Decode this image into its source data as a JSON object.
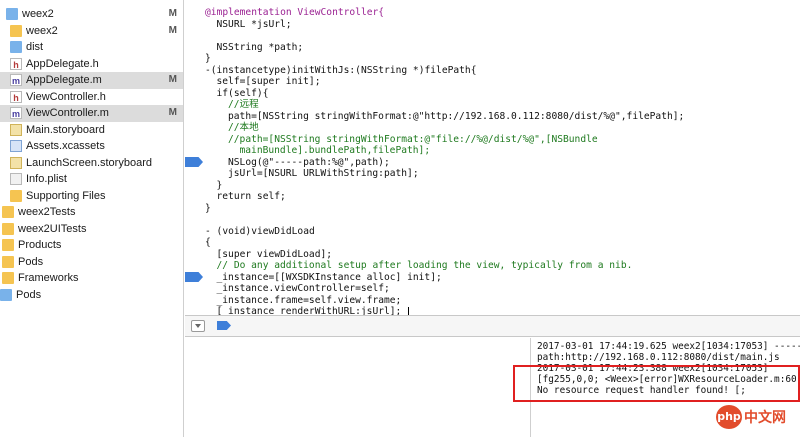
{
  "navigator": {
    "items": [
      {
        "label": "weex2",
        "icon": "project-icon",
        "badge": "M"
      },
      {
        "label": "weex2",
        "icon": "folder-icon",
        "badge": "M"
      },
      {
        "label": "dist",
        "icon": "folder-reference-icon",
        "badge": ""
      },
      {
        "label": "AppDelegate.h",
        "icon": "header-file-icon",
        "badge": ""
      },
      {
        "label": "AppDelegate.m",
        "icon": "implementation-file-icon",
        "badge": "M"
      },
      {
        "label": "ViewController.h",
        "icon": "header-file-icon",
        "badge": ""
      },
      {
        "label": "ViewController.m",
        "icon": "implementation-file-icon",
        "badge": "M"
      },
      {
        "label": "Main.storyboard",
        "icon": "storyboard-icon",
        "badge": ""
      },
      {
        "label": "Assets.xcassets",
        "icon": "asset-catalog-icon",
        "badge": ""
      },
      {
        "label": "LaunchScreen.storyboard",
        "icon": "storyboard-icon",
        "badge": ""
      },
      {
        "label": "Info.plist",
        "icon": "plist-icon",
        "badge": ""
      },
      {
        "label": "Supporting Files",
        "icon": "folder-icon",
        "badge": ""
      },
      {
        "label": "weex2Tests",
        "icon": "folder-icon",
        "badge": ""
      },
      {
        "label": "weex2UITests",
        "icon": "folder-icon",
        "badge": ""
      },
      {
        "label": "Products",
        "icon": "folder-icon",
        "badge": ""
      },
      {
        "label": "Pods",
        "icon": "folder-icon",
        "badge": ""
      },
      {
        "label": "Frameworks",
        "icon": "folder-icon",
        "badge": ""
      },
      {
        "label": "Pods",
        "icon": "project-icon",
        "badge": ""
      }
    ]
  },
  "editor": {
    "lines": [
      {
        "text": "@implementation ViewController{",
        "indent": 0,
        "color": "#9b2393"
      },
      {
        "text": "NSURL *jsUrl;",
        "indent": 2,
        "color": "#111111"
      },
      {
        "text": "",
        "indent": 0,
        "color": "#111111"
      },
      {
        "text": "NSString *path;",
        "indent": 2,
        "color": "#111111"
      },
      {
        "text": "}",
        "indent": 0,
        "color": "#111111"
      },
      {
        "text": "-(instancetype)initWithJs:(NSString *)filePath{",
        "indent": 0,
        "color": "#111111"
      },
      {
        "text": "self=[super init];",
        "indent": 2,
        "color": "#111111"
      },
      {
        "text": "if(self){",
        "indent": 2,
        "color": "#111111"
      },
      {
        "text": "//远程",
        "indent": 4,
        "color": "#1f7a1f"
      },
      {
        "text": "path=[NSString stringWithFormat:@\"http://192.168.0.112:8080/dist/%@\",filePath];",
        "indent": 4,
        "color": "#111111"
      },
      {
        "text": "//本地",
        "indent": 4,
        "color": "#1f7a1f"
      },
      {
        "text": "//path=[NSString stringWithFormat:@\"file://%@/dist/%@\",[NSBundle",
        "indent": 4,
        "color": "#1f7a1f"
      },
      {
        "text": "mainBundle].bundlePath,filePath];",
        "indent": 6,
        "color": "#1f7a1f"
      },
      {
        "text": "NSLog(@\"-----path:%@\",path);",
        "indent": 4,
        "color": "#111111"
      },
      {
        "text": "jsUrl=[NSURL URLWithString:path];",
        "indent": 4,
        "color": "#111111"
      },
      {
        "text": "}",
        "indent": 2,
        "color": "#111111"
      },
      {
        "text": "return self;",
        "indent": 2,
        "color": "#111111"
      },
      {
        "text": "}",
        "indent": 0,
        "color": "#111111"
      },
      {
        "text": "",
        "indent": 0,
        "color": "#111111"
      },
      {
        "text": "- (void)viewDidLoad",
        "indent": 0,
        "color": "#111111"
      },
      {
        "text": "{",
        "indent": 0,
        "color": "#111111"
      },
      {
        "text": "[super viewDidLoad];",
        "indent": 2,
        "color": "#111111"
      },
      {
        "text": "// Do any additional setup after loading the view, typically from a nib.",
        "indent": 2,
        "color": "#1f7a1f"
      },
      {
        "text": "_instance=[[WXSDKInstance alloc] init];",
        "indent": 2,
        "color": "#111111"
      },
      {
        "text": "_instance.viewController=self;",
        "indent": 2,
        "color": "#111111"
      },
      {
        "text": "_instance.frame=self.view.frame;",
        "indent": 2,
        "color": "#111111"
      },
      {
        "text": "[_instance renderWithURL:jsUrl];",
        "indent": 2,
        "color": "#111111"
      }
    ],
    "breakpoint_lines": [
      13,
      23
    ]
  },
  "debug_bar": {
    "hide_icon": "hide-debug-area-icon",
    "breakpoints_icon": "breakpoints-toggle-icon"
  },
  "console": {
    "lines": [
      "2017-03-01 17:44:19.625 weex2[1034:17053] -----",
      "path:http://192.168.0.112:8080/dist/main.js",
      "2017-03-01 17:44:23.388 weex2[1034:17053]",
      "[fg255,0,0; <Weex>[error]WXResourceLoader.m:60,",
      "No resource request handler found! [;"
    ]
  },
  "watermark": {
    "logo_text": "php",
    "text": "中文网"
  },
  "colors": {
    "keyword": "#9b2393",
    "comment": "#1f7a1f",
    "string": "#c41a16",
    "type": "#3d1d81",
    "breakpoint": "#3e7fd9",
    "highlight_box": "#e02020"
  }
}
